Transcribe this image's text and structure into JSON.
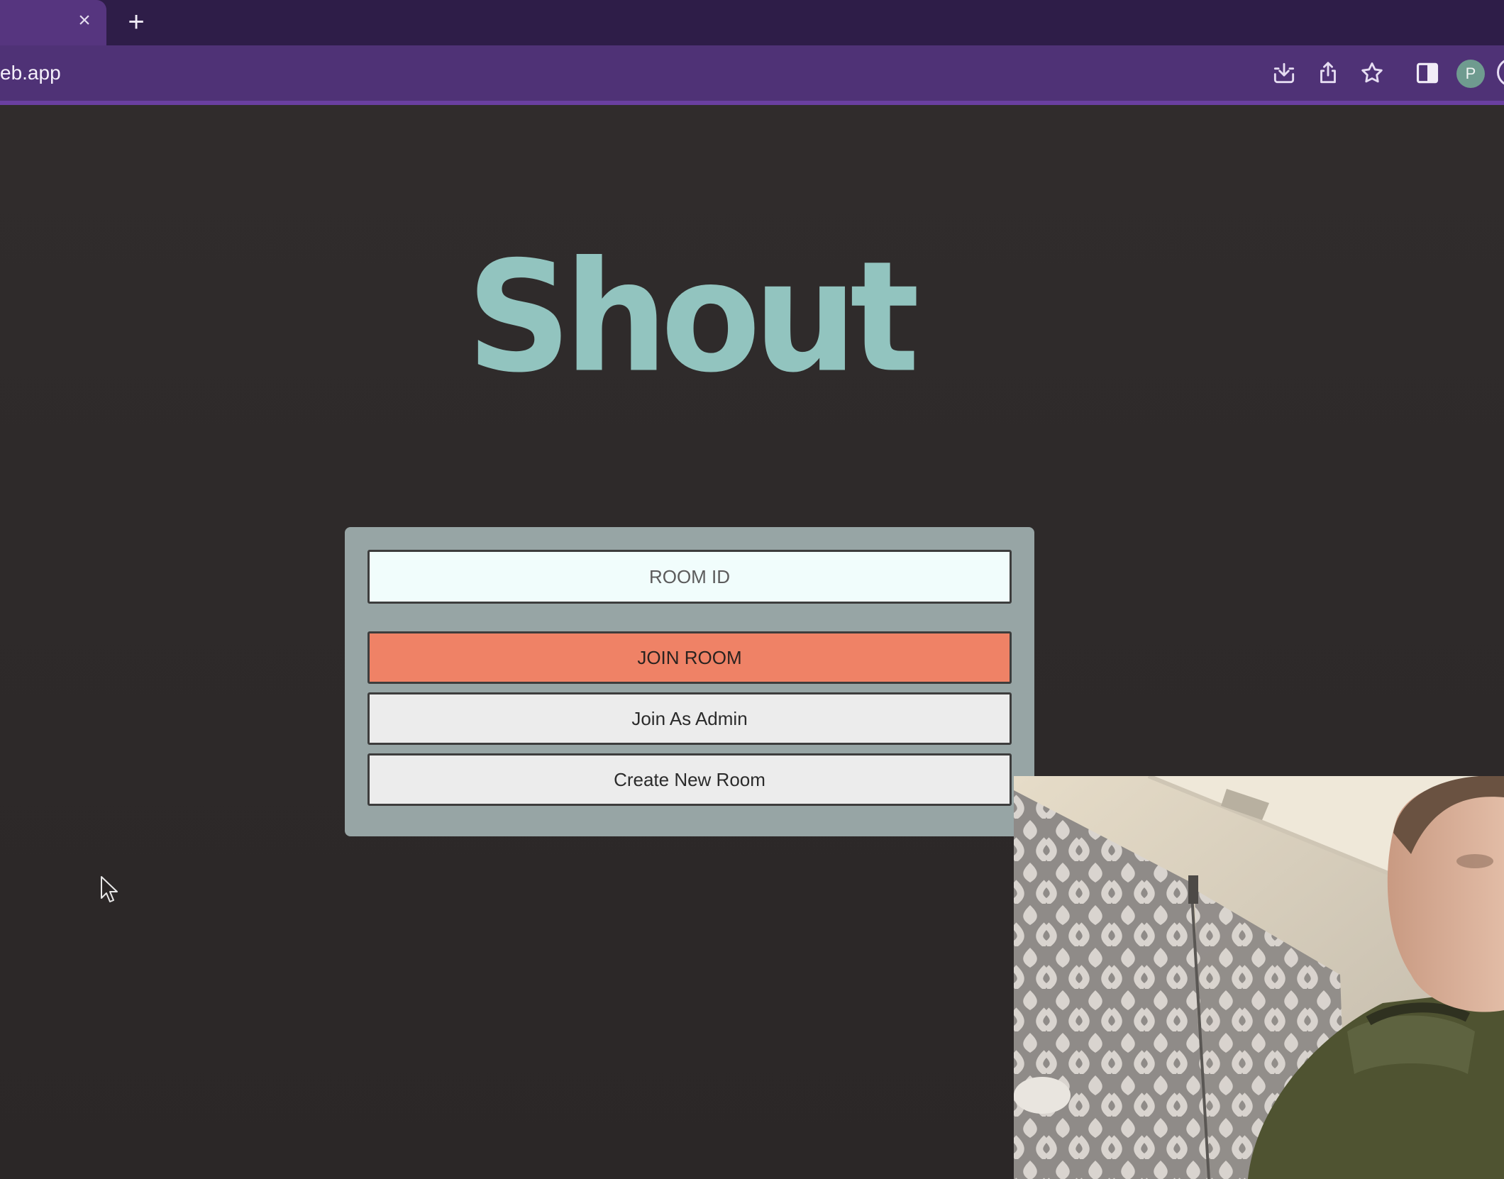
{
  "browser": {
    "tab_close_glyph": "×",
    "new_tab_glyph": "+",
    "address_bar_text": "eb.app",
    "profile_initial": "P",
    "toolbar_icons": [
      "install-app-icon",
      "share-icon",
      "bookmark-star-icon",
      "side-panel-icon"
    ],
    "accent_color": "#4f3276"
  },
  "app": {
    "logo_text": "Shout",
    "logo_color": "#92c4bf",
    "room_id_placeholder": "ROOM ID",
    "join_room_label": "JOIN ROOM",
    "join_admin_label": "Join As Admin",
    "create_room_label": "Create New Room",
    "join_button_color": "#ef8266"
  }
}
